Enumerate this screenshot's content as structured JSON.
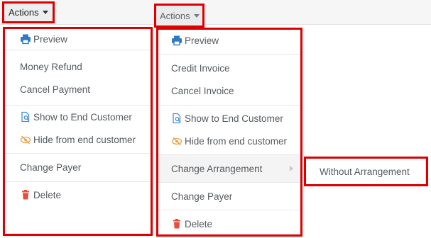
{
  "left_panel": {
    "actions_label": "Actions",
    "items": [
      {
        "label": "Preview",
        "icon": "printer-icon",
        "icon_color": "#2e7bc4"
      },
      {
        "label": "Money Refund"
      },
      {
        "label": "Cancel Payment"
      },
      {
        "label": "Show to End Customer",
        "icon": "document-search-icon",
        "icon_color": "#4a90d9"
      },
      {
        "label": "Hide from end customer",
        "icon": "eye-slash-icon",
        "icon_color": "#e8a24a"
      },
      {
        "label": "Change Payer"
      },
      {
        "label": "Delete",
        "icon": "trash-icon",
        "icon_color": "#e74c3c"
      }
    ]
  },
  "right_panel": {
    "actions_label": "Actions",
    "items": [
      {
        "label": "Preview",
        "icon": "printer-icon",
        "icon_color": "#2e7bc4"
      },
      {
        "label": "Credit Invoice"
      },
      {
        "label": "Cancel Invoice"
      },
      {
        "label": "Show to End Customer",
        "icon": "document-search-icon",
        "icon_color": "#4a90d9"
      },
      {
        "label": "Hide from end customer",
        "icon": "eye-slash-icon",
        "icon_color": "#e8a24a"
      },
      {
        "label": "Change Arrangement"
      },
      {
        "label": "Change Payer"
      },
      {
        "label": "Delete",
        "icon": "trash-icon",
        "icon_color": "#e74c3c"
      }
    ],
    "submenu": {
      "items": [
        {
          "label": "Without Arrangement"
        }
      ]
    }
  },
  "highlight_color": "#dd0000"
}
